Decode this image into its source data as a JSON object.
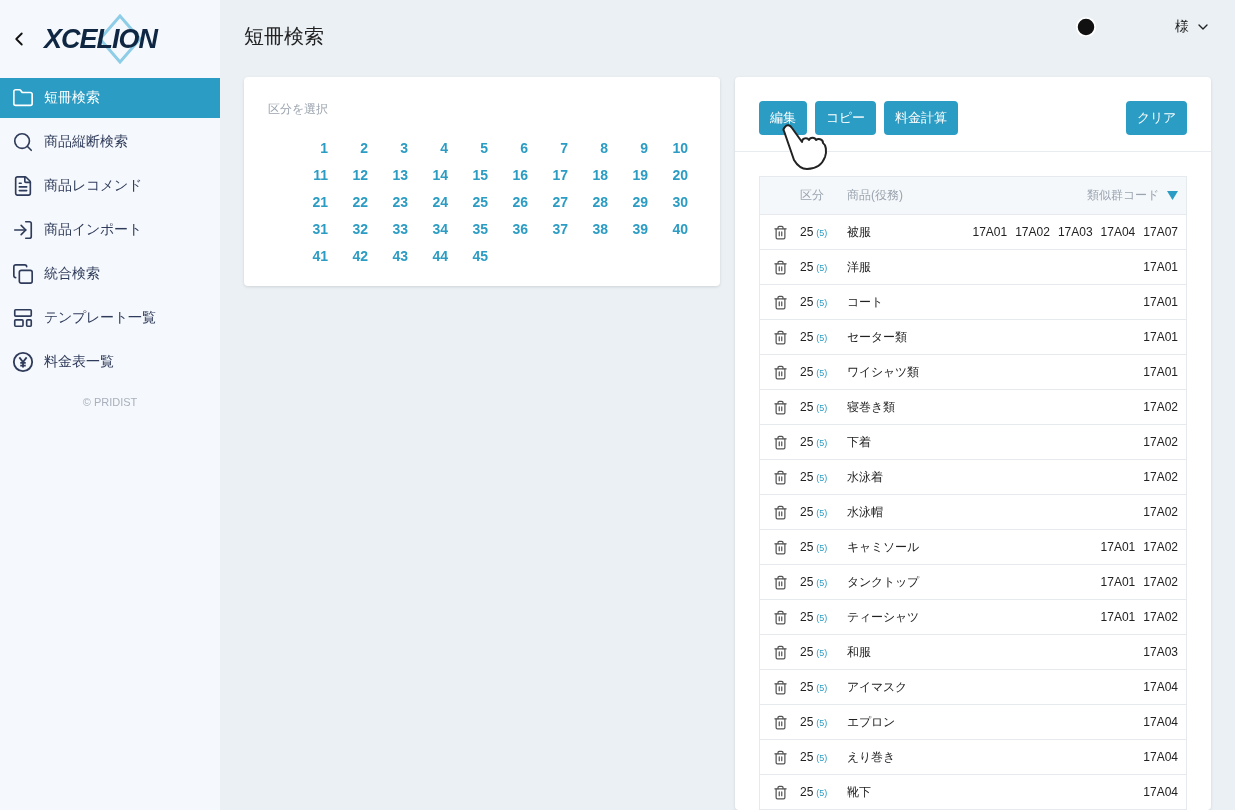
{
  "logo": {
    "text": "XCELION"
  },
  "sidebar": {
    "items": [
      {
        "label": "短冊検索",
        "selected": true
      },
      {
        "label": "商品縦断検索",
        "selected": false
      },
      {
        "label": "商品レコメンド",
        "selected": false
      },
      {
        "label": "商品インポート",
        "selected": false
      },
      {
        "label": "統合検索",
        "selected": false
      },
      {
        "label": "テンプレート一覧",
        "selected": false
      },
      {
        "label": "料金表一覧",
        "selected": false
      }
    ],
    "copyright": "© PRIDIST"
  },
  "header": {
    "title": "短冊検索",
    "user_suffix": "様"
  },
  "class_picker": {
    "label": "区分を選択",
    "numbers": [
      "1",
      "2",
      "3",
      "4",
      "5",
      "6",
      "7",
      "8",
      "9",
      "10",
      "11",
      "12",
      "13",
      "14",
      "15",
      "16",
      "17",
      "18",
      "19",
      "20",
      "21",
      "22",
      "23",
      "24",
      "25",
      "26",
      "27",
      "28",
      "29",
      "30",
      "31",
      "32",
      "33",
      "34",
      "35",
      "36",
      "37",
      "38",
      "39",
      "40",
      "41",
      "42",
      "43",
      "44",
      "45"
    ]
  },
  "toolbar": {
    "buttons": [
      "編集",
      "コピー",
      "料金計算"
    ],
    "clear": "クリア"
  },
  "table": {
    "columns": [
      "区分",
      "商品(役務)",
      "類似群コード"
    ],
    "rows": [
      {
        "class": "25",
        "sub": "(5)",
        "item": "被服",
        "codes": [
          "17A01",
          "17A02",
          "17A03",
          "17A04",
          "17A07"
        ]
      },
      {
        "class": "25",
        "sub": "(5)",
        "item": "洋服",
        "codes": [
          "17A01"
        ]
      },
      {
        "class": "25",
        "sub": "(5)",
        "item": "コート",
        "codes": [
          "17A01"
        ]
      },
      {
        "class": "25",
        "sub": "(5)",
        "item": "セーター類",
        "codes": [
          "17A01"
        ]
      },
      {
        "class": "25",
        "sub": "(5)",
        "item": "ワイシャツ類",
        "codes": [
          "17A01"
        ]
      },
      {
        "class": "25",
        "sub": "(5)",
        "item": "寝巻き類",
        "codes": [
          "17A02"
        ]
      },
      {
        "class": "25",
        "sub": "(5)",
        "item": "下着",
        "codes": [
          "17A02"
        ]
      },
      {
        "class": "25",
        "sub": "(5)",
        "item": "水泳着",
        "codes": [
          "17A02"
        ]
      },
      {
        "class": "25",
        "sub": "(5)",
        "item": "水泳帽",
        "codes": [
          "17A02"
        ]
      },
      {
        "class": "25",
        "sub": "(5)",
        "item": "キャミソール",
        "codes": [
          "17A01",
          "17A02"
        ]
      },
      {
        "class": "25",
        "sub": "(5)",
        "item": "タンクトップ",
        "codes": [
          "17A01",
          "17A02"
        ]
      },
      {
        "class": "25",
        "sub": "(5)",
        "item": "ティーシャツ",
        "codes": [
          "17A01",
          "17A02"
        ]
      },
      {
        "class": "25",
        "sub": "(5)",
        "item": "和服",
        "codes": [
          "17A03"
        ]
      },
      {
        "class": "25",
        "sub": "(5)",
        "item": "アイマスク",
        "codes": [
          "17A04"
        ]
      },
      {
        "class": "25",
        "sub": "(5)",
        "item": "エプロン",
        "codes": [
          "17A04"
        ]
      },
      {
        "class": "25",
        "sub": "(5)",
        "item": "えり巻き",
        "codes": [
          "17A04"
        ]
      },
      {
        "class": "25",
        "sub": "(5)",
        "item": "靴下",
        "codes": [
          "17A04"
        ]
      }
    ]
  }
}
